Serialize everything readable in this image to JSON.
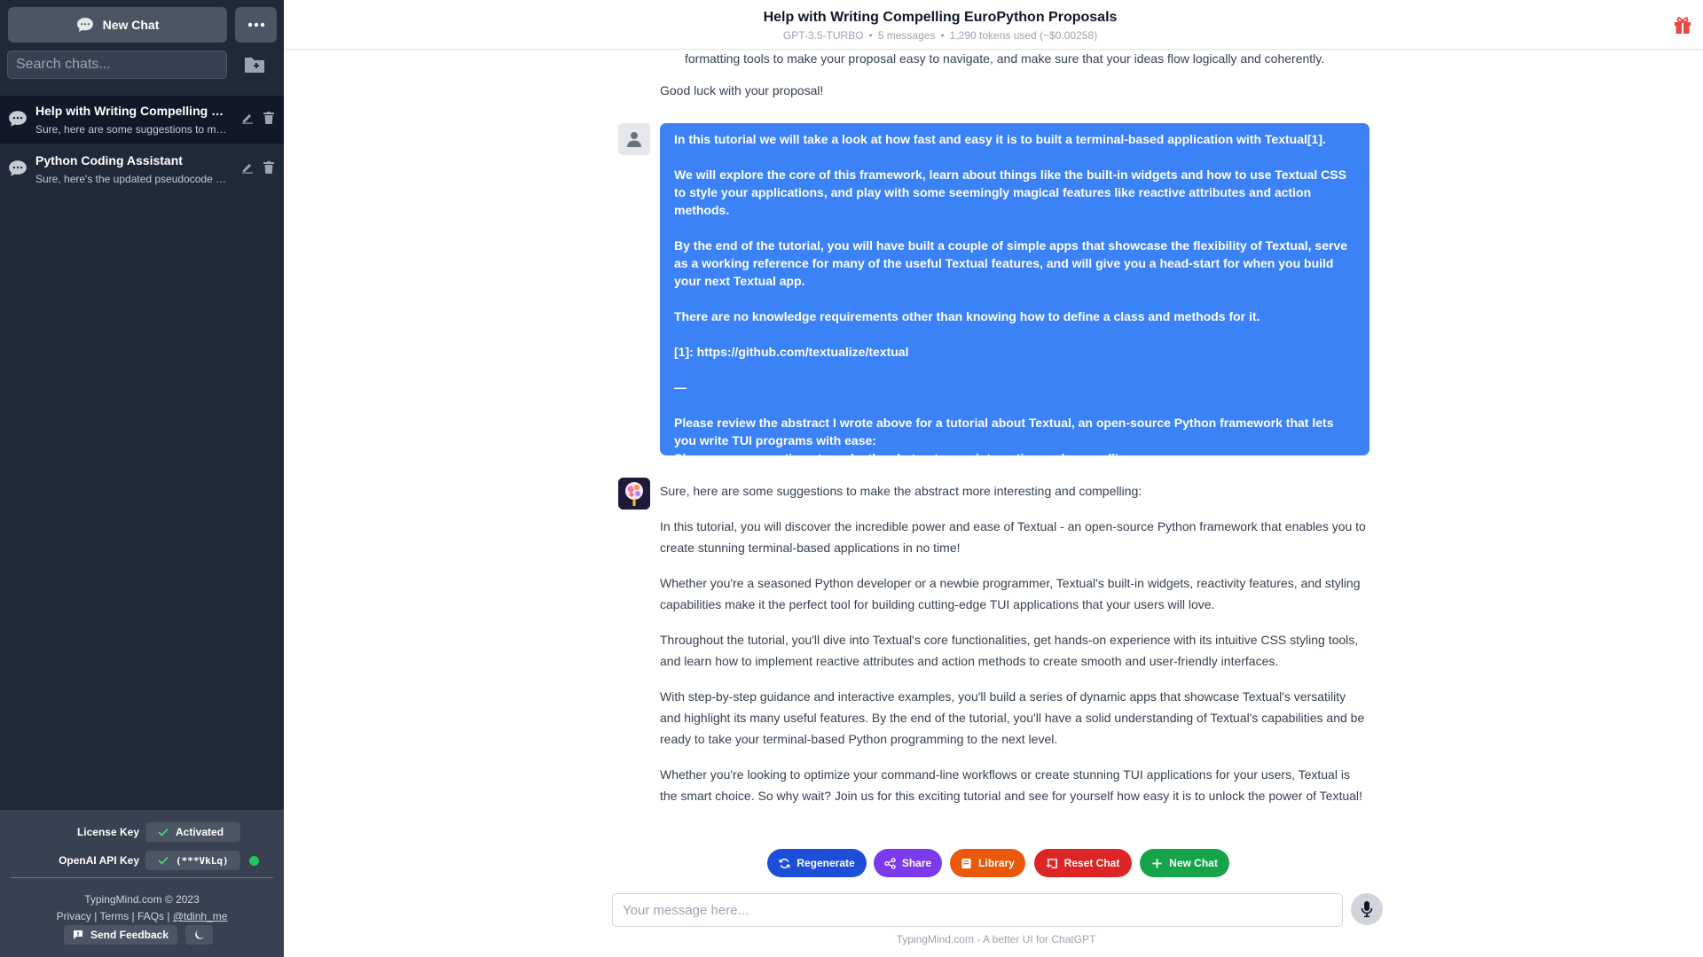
{
  "sidebar": {
    "new_chat_label": "New Chat",
    "more_icon": "more-dots-icon",
    "search_placeholder": "Search chats...",
    "chats": [
      {
        "title": "Help with Writing Compelling EuroPython Proposals",
        "preview": "Sure, here are some suggestions to make the abstract more interesting",
        "active": true
      },
      {
        "title": "Python Coding Assistant",
        "preview": "Sure, here's the updated pseudocode for the",
        "active": false
      }
    ],
    "license_label": "License Key",
    "license_value": "Activated",
    "api_label": "OpenAI API Key",
    "api_value": "(***VkLq)",
    "copyright": "TypingMind.com © 2023",
    "links": {
      "privacy": "Privacy",
      "terms": "Terms",
      "faqs": "FAQs",
      "handle": "@tdinh_me",
      "sep": "|"
    },
    "feedback_label": "Send Feedback"
  },
  "header": {
    "title": "Help with Writing Compelling EuroPython Proposals",
    "model": "GPT-3.5-TURBO",
    "messages": "5 messages",
    "tokens": "1,290 tokens used (~$0.00258)",
    "meta_separator": "•"
  },
  "conversation": {
    "prev_fragment": "formatting tools to make your proposal easy to navigate, and make sure that your ideas flow logically and coherently.",
    "prev_closing": "Good luck with your proposal!",
    "user_message": [
      "In this tutorial we will take a look at how fast and easy it is to built a terminal-based application with Textual[1].",
      "We will explore the core of this framework, learn about things like the built-in widgets and how to use Textual CSS to style your applications, and play with some seemingly magical features like reactive attributes and action methods.",
      "By the end of the tutorial, you will have built a couple of simple apps that showcase the flexibility of Textual, serve as a working reference for many of the useful Textual features, and will give you a head-start for when you build your next Textual app.",
      "There are no knowledge requirements other than knowing how to define a class and methods for it.",
      "[1]: https://github.com/textualize/textual",
      "—",
      "Please review the abstract I wrote above for a tutorial about Textual, an open-source Python framework that lets you write TUI programs with ease:",
      "Show your suggestions to make the abstract more interesting and compelling."
    ],
    "assistant_message": [
      "Sure, here are some suggestions to make the abstract more interesting and compelling:",
      "In this tutorial, you will discover the incredible power and ease of Textual - an open-source Python framework that enables you to create stunning terminal-based applications in no time!",
      "Whether you're a seasoned Python developer or a newbie programmer, Textual's built-in widgets, reactivity features, and styling capabilities make it the perfect tool for building cutting-edge TUI applications that your users will love.",
      "Throughout the tutorial, you'll dive into Textual's core functionalities, get hands-on experience with its intuitive CSS styling tools, and learn how to implement reactive attributes and action methods to create smooth and user-friendly interfaces.",
      "With step-by-step guidance and interactive examples, you'll build a series of dynamic apps that showcase Textual's versatility and highlight its many useful features. By the end of the tutorial, you'll have a solid understanding of Textual's capabilities and be ready to take your terminal-based Python programming to the next level.",
      "Whether you're looking to optimize your command-line workflows or create stunning TUI applications for your users, Textual is the smart choice. So why wait? Join us for this exciting tutorial and see for yourself how easy it is to unlock the power of Textual!"
    ]
  },
  "actions": [
    {
      "label": "Regenerate",
      "color": "#1d4ed8",
      "icon": "regenerate-icon"
    },
    {
      "label": "Share",
      "color": "#7c3aed",
      "icon": "share-icon"
    },
    {
      "label": "Library",
      "color": "#ea580c",
      "icon": "library-icon"
    },
    {
      "label": "Reset Chat",
      "color": "#dc2626",
      "icon": "reset-icon"
    },
    {
      "label": "New Chat",
      "color": "#16a34a",
      "icon": "plus-icon"
    }
  ],
  "composer": {
    "placeholder": "Your message here..."
  },
  "footer": "TypingMind.com - A better UI for ChatGPT",
  "colors": {
    "sidebar_bg": "#202938",
    "user_bubble": "#3b82f6",
    "status_ok": "#22c55e",
    "gift": "#ef4444"
  }
}
